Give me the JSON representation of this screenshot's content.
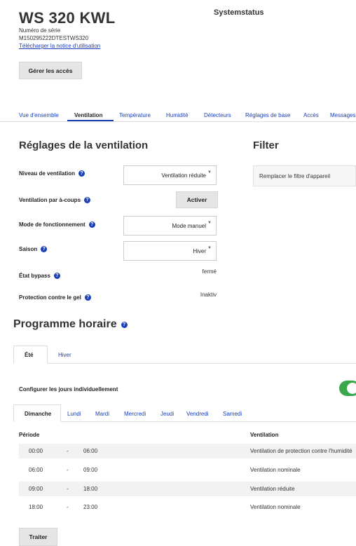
{
  "header": {
    "device_title": "WS 320 KWL",
    "system_status": "Systemstatus",
    "serial_label": "Numéro de série",
    "serial_value": "M150295222DTESTWS320",
    "manual_link": "Télécharger la notice d'utilisation",
    "access_button": "Gérer les accès"
  },
  "tabs": [
    {
      "label": "Vue d'ensemble"
    },
    {
      "label": "Ventilation"
    },
    {
      "label": "Température"
    },
    {
      "label": "Humidité"
    },
    {
      "label": "Détecteurs"
    },
    {
      "label": "Réglages de base"
    },
    {
      "label": "Accès"
    },
    {
      "label": "Messages"
    }
  ],
  "active_tab": "Ventilation",
  "settings": {
    "title": "Réglages de la ventilation",
    "ventilation_level_label": "Niveau de ventilation",
    "ventilation_level_value": "Ventilation réduite",
    "boost_label": "Ventilation par à-coups",
    "boost_button": "Activer",
    "mode_label": "Mode de fonctionnement",
    "mode_value": "Mode manuel",
    "season_label": "Saison",
    "season_value": "Hiver",
    "bypass_label": "État bypass",
    "bypass_value": "fermé",
    "frost_label": "Protection contre le gel",
    "frost_value": "Inaktiv"
  },
  "filter": {
    "title": "Filter",
    "replace_text": "Remplacer le filtre d'appareil"
  },
  "schedule": {
    "title": "Programme horaire",
    "season_tabs": [
      "Été",
      "Hiver"
    ],
    "active_season": "Été",
    "individual_days_label": "Configurer les jours individuellement",
    "individual_days_enabled": true,
    "day_tabs": [
      "Dimanche",
      "Lundi",
      "Mardi",
      "Mercredi",
      "Jeudi",
      "Vendredi",
      "Samedi"
    ],
    "active_day": "Dimanche",
    "col_period": "Période",
    "col_ventilation": "Ventilation",
    "rows": [
      {
        "start": "00:00",
        "sep": "-",
        "end": "06:00",
        "mode": "Ventilation de protection contre l'humidité"
      },
      {
        "start": "06:00",
        "sep": "-",
        "end": "09:00",
        "mode": "Ventilation nominale"
      },
      {
        "start": "09:00",
        "sep": "-",
        "end": "18:00",
        "mode": "Ventilation réduite"
      },
      {
        "start": "18:00",
        "sep": "-",
        "end": "23:00",
        "mode": "Ventilation nominale"
      }
    ],
    "edit_button": "Traiter"
  },
  "colors": {
    "link": "#1a3fb8",
    "toggle_on": "#3aa84a",
    "button_bg": "#e5e5e5"
  }
}
